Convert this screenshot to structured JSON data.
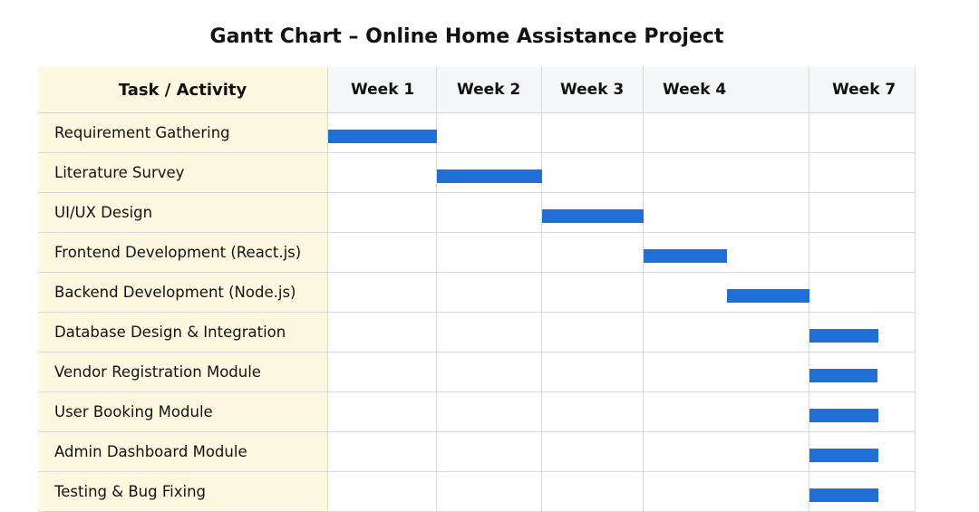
{
  "title": "Gantt Chart – Online Home Assistance Project",
  "header": {
    "task_column": "Task / Activity"
  },
  "colors": {
    "bar": "#1f6fd6",
    "task_column_bg": "#fdf9e1",
    "header_bg": "#f6f7f9",
    "grid_line": "#d9d9d9"
  },
  "chart_data": {
    "type": "gantt",
    "columns": [
      "Week 1",
      "Week 2",
      "Week 3",
      "Week 4",
      "Week 7"
    ],
    "tasks": [
      {
        "name": "Requirement Gathering",
        "start": 0,
        "end": 1
      },
      {
        "name": "Literature Survey",
        "start": 1,
        "end": 2
      },
      {
        "name": "UI/UX Design",
        "start": 2,
        "end": 3
      },
      {
        "name": "Frontend Development (React.js)",
        "start": 3,
        "end": 3.5
      },
      {
        "name": "Backend Development (Node.js)",
        "start": 3.5,
        "end": 4
      },
      {
        "name": "Database Design & Integration",
        "start": 4,
        "end": 4.65
      },
      {
        "name": "Vendor Registration Module",
        "start": 4,
        "end": 4.64
      },
      {
        "name": "User Booking Module",
        "start": 4,
        "end": 4.65
      },
      {
        "name": "Admin Dashboard Module",
        "start": 4,
        "end": 4.65
      },
      {
        "name": "Testing & Bug Fixing",
        "start": 4,
        "end": 4.65
      }
    ]
  }
}
